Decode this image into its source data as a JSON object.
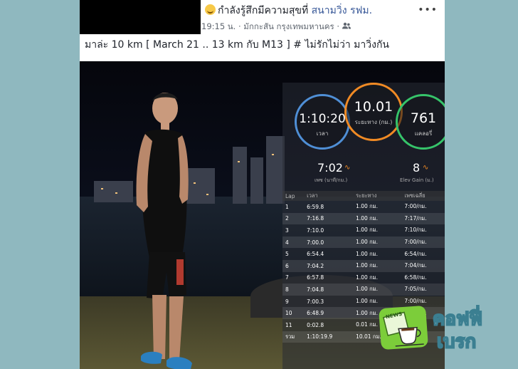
{
  "post": {
    "feeling_prefix": "กำลังรู้สึกมีความสุขที่",
    "place": "สนามวิ่ง รฟม.",
    "time": "19:15 น.",
    "location": "มักกะสัน กรุงเทพมหานคร",
    "more_label": "•••",
    "caption": "มาล่ะ 10 km [ March 21 .. 13 km กับ M13 ] # ไม่รักไม่ว่า มาวิ่งกัน"
  },
  "run_stats": {
    "time_value": "1:10:20",
    "time_label": "เวลา",
    "distance_value": "10.01",
    "distance_label": "ระยะทาง (กม.)",
    "calories_value": "761",
    "calories_label": "แคลอรี่",
    "pace_value": "7:02",
    "pace_label": "เพซ (นาที/กม.)",
    "elev_value": "8",
    "elev_label": "Elev Gain (ม.)",
    "ring_colors": {
      "time": "#4f8fd6",
      "distance": "#f08a24",
      "calories": "#36c46a"
    }
  },
  "laps_table": {
    "headers": [
      "Lap",
      "เวลา",
      "ระยะทาง",
      "เพซเฉลี่ย"
    ],
    "rows": [
      [
        "1",
        "6:59.8",
        "1.00 กม.",
        "7:00/กม."
      ],
      [
        "2",
        "7:16.8",
        "1.00 กม.",
        "7:17/กม."
      ],
      [
        "3",
        "7:10.0",
        "1.00 กม.",
        "7:10/กม."
      ],
      [
        "4",
        "7:00.0",
        "1.00 กม.",
        "7:00/กม."
      ],
      [
        "5",
        "6:54.4",
        "1.00 กม.",
        "6:54/กม."
      ],
      [
        "6",
        "7:04.2",
        "1.00 กม.",
        "7:04/กม."
      ],
      [
        "7",
        "6:57.8",
        "1.00 กม.",
        "6:58/กม."
      ],
      [
        "8",
        "7:04.8",
        "1.00 กม.",
        "7:05/กม."
      ],
      [
        "9",
        "7:00.3",
        "1.00 กม.",
        "7:00/กม."
      ],
      [
        "10",
        "6:48.9",
        "1.00 กม.",
        "6:49/กม."
      ],
      [
        "11",
        "0:02.8",
        "0.01 กม.",
        ""
      ],
      [
        "รวม",
        "1:10:19.9",
        "10.01 กม.",
        ""
      ]
    ]
  },
  "watermark": {
    "line1": "คอฟฟี่",
    "line2": "เบรก",
    "icon_text": "NEWS"
  }
}
